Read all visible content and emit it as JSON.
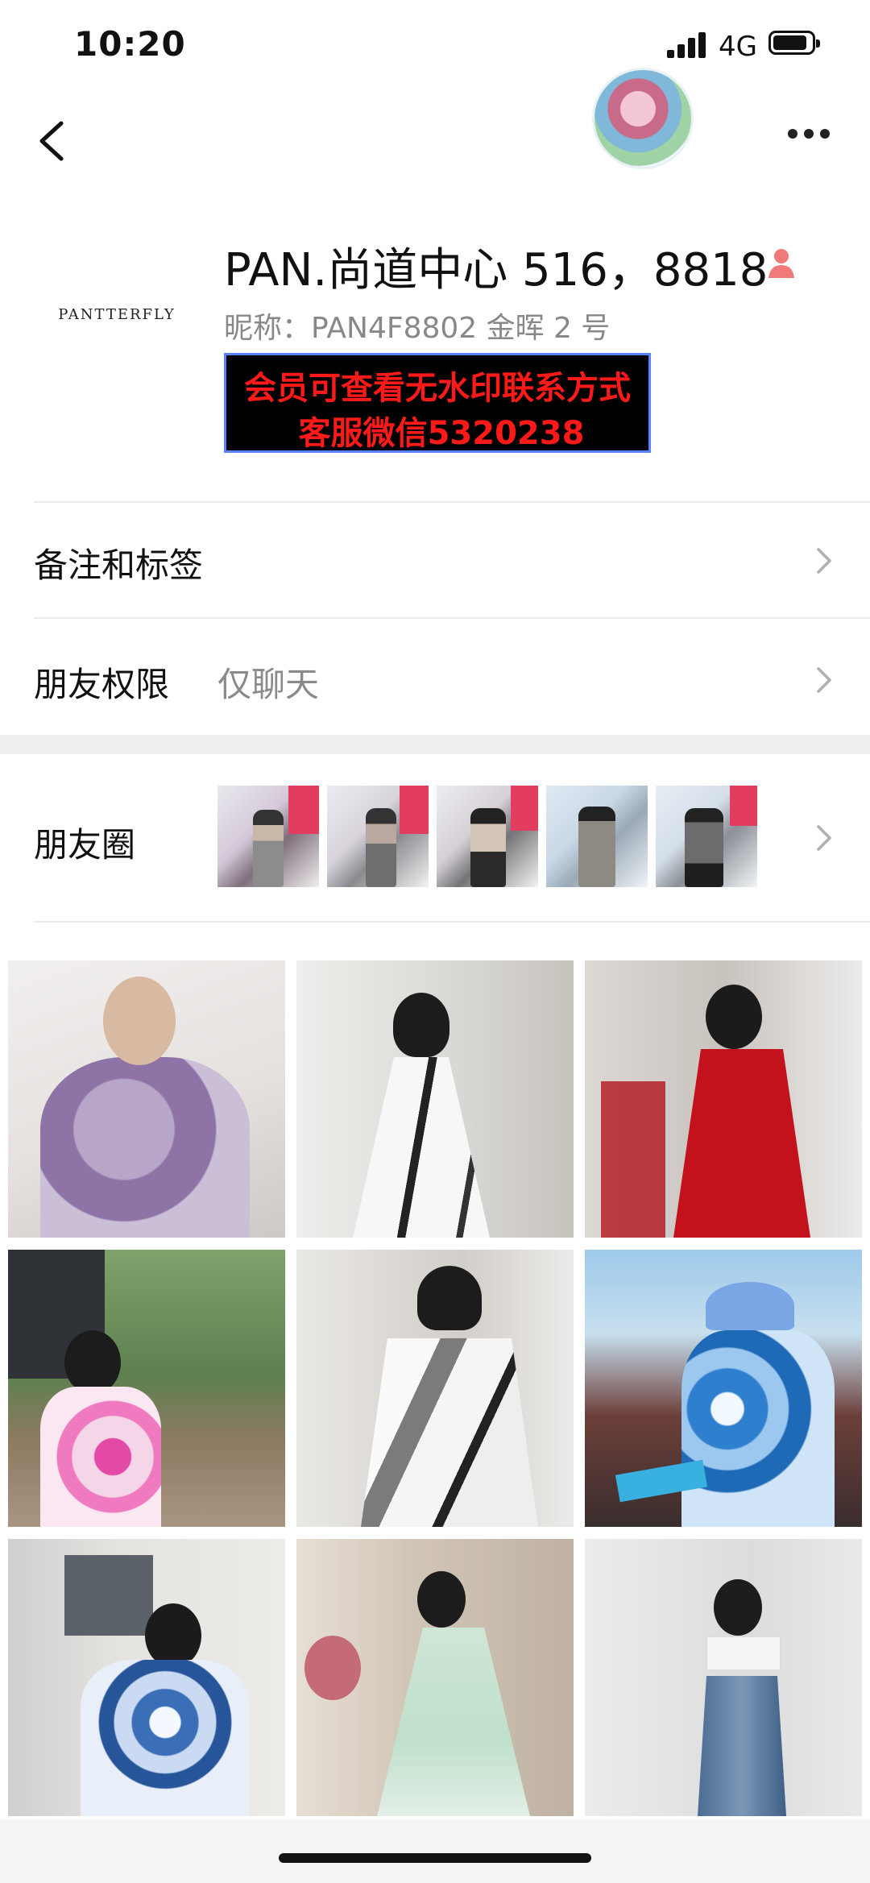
{
  "status_bar": {
    "time": "10:20",
    "network": "4G"
  },
  "profile": {
    "logo_text": "PANTTERFLY",
    "name": "PAN.尚道中心 516，8818",
    "nickname": "昵称：PAN4F8802 金晖 2 号",
    "banner_line1": "会员可查看无水印联系方式",
    "banner_line2": "客服微信5320238"
  },
  "rows": {
    "remarks_label": "备注和标签",
    "permissions_label": "朋友权限",
    "permissions_value": "仅聊天",
    "moments_label": "朋友圈"
  },
  "colors": {
    "accent_red": "#ff1a1a",
    "banner_border": "#5b82ff",
    "female_icon": "#f07a7a"
  },
  "icons": [
    "back-icon",
    "more-icon",
    "chevron-right-icon",
    "female-icon"
  ]
}
